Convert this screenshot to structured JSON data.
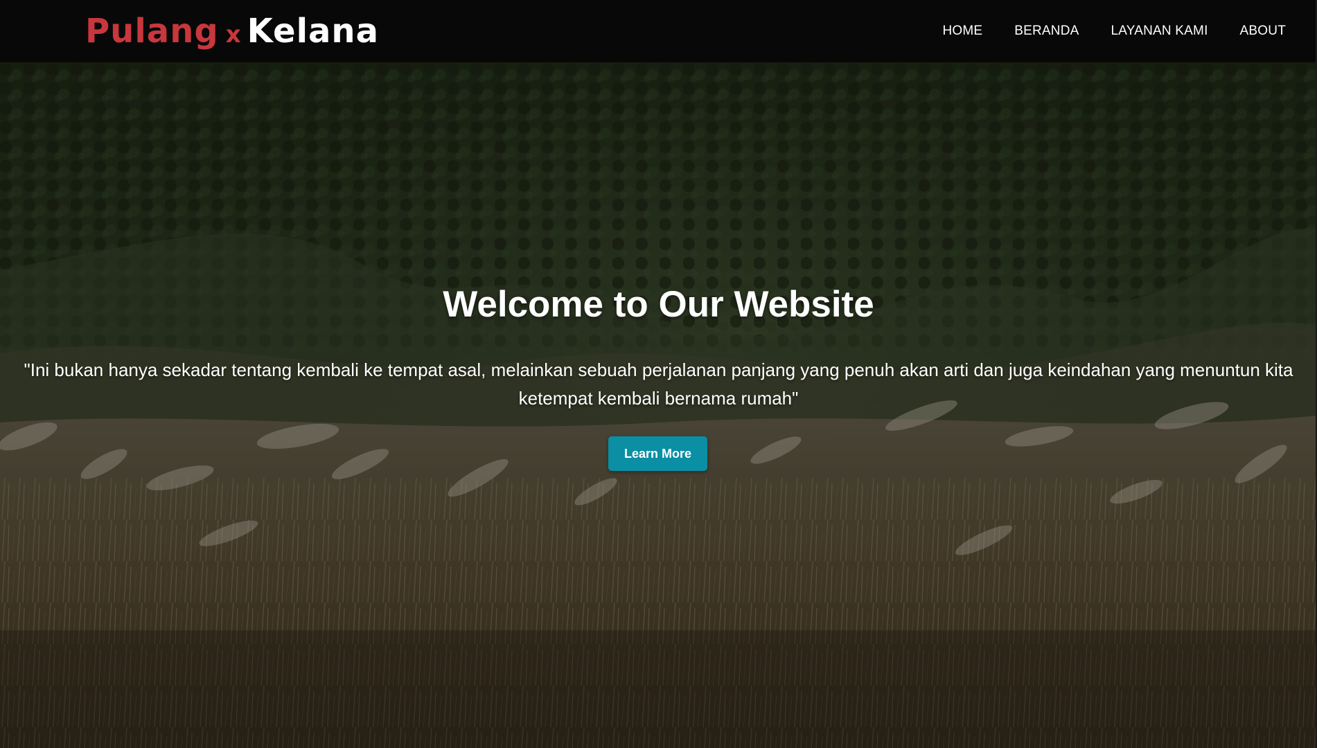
{
  "navbar": {
    "logo_part1": "Pulang",
    "logo_separator": "x",
    "logo_part2": "Kelana",
    "links": [
      {
        "label": "HOME"
      },
      {
        "label": "BERANDA"
      },
      {
        "label": "LAYANAN KAMI"
      },
      {
        "label": "ABOUT"
      }
    ]
  },
  "hero": {
    "title": "Welcome to Our Website",
    "quote": "\"Ini bukan hanya sekadar tentang kembali ke tempat asal, melainkan sebuah perjalanan panjang yang penuh akan arti dan juga keindahan yang menuntun kita ketempat kembali bernama rumah\"",
    "button_label": "Learn More"
  },
  "colors": {
    "navbar_bg": "#080808",
    "logo_red": "#c8373d",
    "button_bg": "#0a8fa4",
    "text": "#ffffff"
  }
}
